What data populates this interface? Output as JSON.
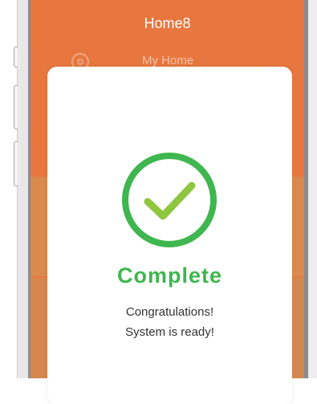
{
  "app": {
    "title": "Home8",
    "nav_label": "My Home"
  },
  "dialog": {
    "status_icon": "checkmark-circle-icon",
    "title": "Complete",
    "message_line1": "Congratulations!",
    "message_line2": "System is ready!"
  },
  "colors": {
    "header_orange": "#e8773f",
    "success_green": "#3fb64f",
    "check_lime": "#8ec63f",
    "dialog_background": "#ffffff"
  }
}
